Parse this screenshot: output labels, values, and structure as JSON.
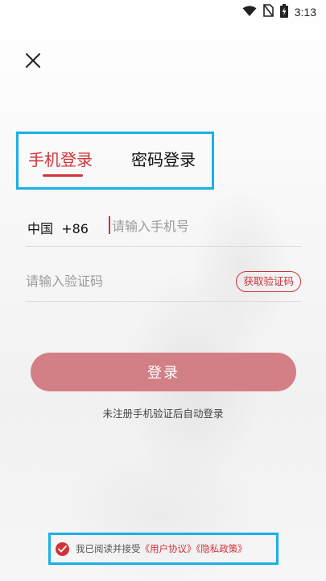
{
  "status_bar": {
    "time": "3:13",
    "icons": [
      "wifi-icon",
      "no-sim-icon",
      "battery-charging-icon"
    ]
  },
  "header": {
    "close_icon": "close-icon"
  },
  "tabs": {
    "phone_login": "手机登录",
    "password_login": "密码登录",
    "active": "phone_login"
  },
  "phone": {
    "country": "中国",
    "code": "+86",
    "placeholder": "请输入手机号",
    "value": ""
  },
  "verification": {
    "placeholder": "请输入验证码",
    "value": "",
    "get_code_label": "获取验证码"
  },
  "login_button": "登录",
  "hint": "未注册手机验证后自动登录",
  "agreement": {
    "checked": true,
    "prefix": "我已阅读并接受",
    "user_agreement": "《用户协议》",
    "privacy_policy": "《隐私政策》"
  },
  "colors": {
    "accent": "#d1323a",
    "login_button": "#d27f86",
    "highlight_box": "#1ab0e8"
  }
}
